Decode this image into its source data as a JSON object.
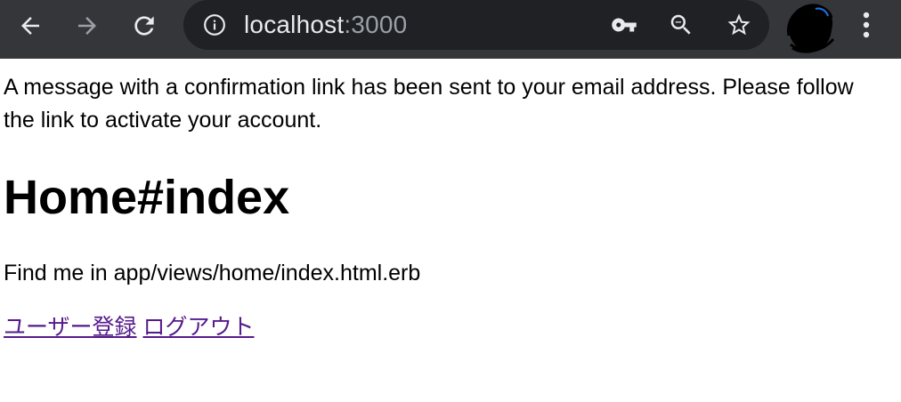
{
  "browser": {
    "url_host": "localhost",
    "url_port": ":3000",
    "icons": {
      "back": "arrow-left-icon",
      "forward": "arrow-right-icon",
      "reload": "reload-icon",
      "info": "info-icon",
      "key": "key-icon",
      "zoom": "zoom-out-icon",
      "bookmark": "star-icon",
      "profile": "avatar",
      "menu": "more-vertical-icon"
    },
    "colors": {
      "toolbar": "#35363a",
      "omnibox": "#202124",
      "icon": "#e8eaed",
      "icon_disabled": "#9aa0a6"
    }
  },
  "page": {
    "notice": "A message with a confirmation link has been sent to your email address. Please follow the link to activate your account.",
    "title": "Home#index",
    "description": "Find me in app/views/home/index.html.erb",
    "links": {
      "register": "ユーザー登録",
      "logout": "ログアウト"
    },
    "link_color": "#551a8b"
  }
}
